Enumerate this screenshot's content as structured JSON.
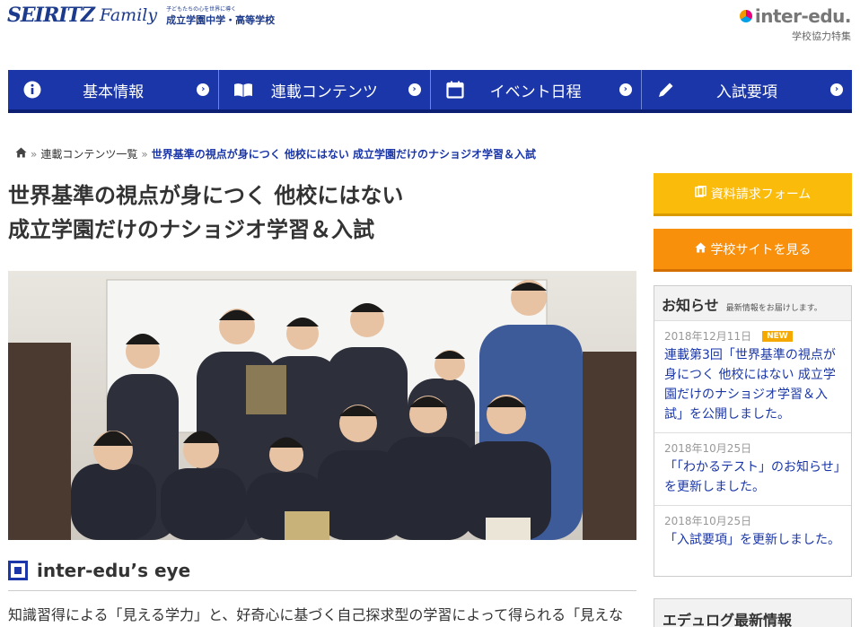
{
  "header": {
    "brand_mark": "SEIRITZ",
    "brand_family": "Family",
    "tagline": "子どもたちの心を世界に導く",
    "school_name": "成立学園中学・高等学校",
    "partner_logo": "inter-edu.",
    "partner_sub": "学校協力特集"
  },
  "nav": [
    {
      "label": "基本情報",
      "icon": "info-icon"
    },
    {
      "label": "連載コンテンツ",
      "icon": "book-icon"
    },
    {
      "label": "イベント日程",
      "icon": "calendar-icon"
    },
    {
      "label": "入試要項",
      "icon": "pencil-icon"
    }
  ],
  "breadcrumb": {
    "home_icon": "home-icon",
    "parent": "連載コンテンツ一覧",
    "current": "世界基準の視点が身につく 他校にはない 成立学園だけのナショジオ学習＆入試"
  },
  "article": {
    "title_line1": "世界基準の視点が身につく 他校にはない",
    "title_line2": "成立学園だけのナショジオ学習＆入試",
    "eye_title": "inter-edu’s eye",
    "eye_text": "知識習得による「見える学力」と、好奇心に基づく自己探求型の学習によって得られる「見えな"
  },
  "sidebar": {
    "request_button": "資料請求フォーム",
    "site_button": "学校サイトを見る",
    "news_title": "お知らせ",
    "news_sub": "最新情報をお届けします。",
    "news_items": [
      {
        "date": "2018年12月11日",
        "badge": "NEW",
        "text": "連載第3回「世界基準の視点が身につく 他校にはない 成立学園だけのナショジオ学習＆入試」を公開しました。"
      },
      {
        "date": "2018年10月25日",
        "badge": "",
        "text": "「「わかるテスト」のお知らせ」を更新しました。"
      },
      {
        "date": "2018年10月25日",
        "badge": "",
        "text": "「入試要項」を更新しました。"
      }
    ],
    "edulog_title": "エデュログ最新情報"
  },
  "colors": {
    "nav_blue": "#1a36a8",
    "request_yellow": "#fbbb0a",
    "site_orange": "#f8900c",
    "new_badge": "#f5a800"
  }
}
